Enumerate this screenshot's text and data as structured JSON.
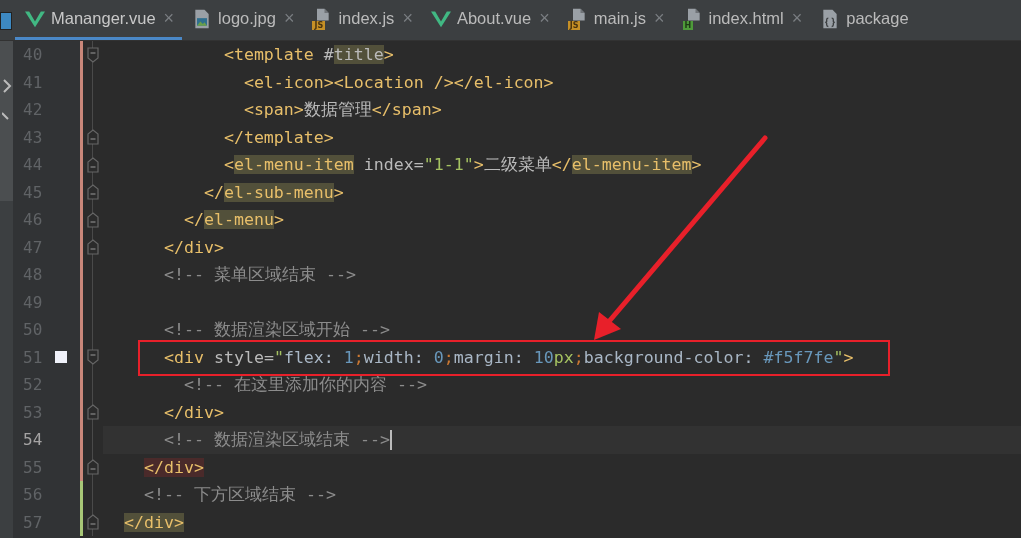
{
  "tabs": [
    {
      "label": "Mananger.vue",
      "kind": "vue",
      "selected": true,
      "close": "×"
    },
    {
      "label": "logo.jpg",
      "kind": "image",
      "selected": false,
      "close": "×"
    },
    {
      "label": "index.js",
      "kind": "js",
      "badge": "JS",
      "selected": false,
      "close": "×"
    },
    {
      "label": "About.vue",
      "kind": "vue",
      "selected": false,
      "close": "×"
    },
    {
      "label": "main.js",
      "kind": "js",
      "badge": "JS",
      "selected": false,
      "close": "×"
    },
    {
      "label": "index.html",
      "kind": "html",
      "badge": "H",
      "selected": false,
      "close": "×"
    },
    {
      "label": "package",
      "kind": "json",
      "selected": false
    }
  ],
  "lines": [
    {
      "number": "40",
      "fold_start": true,
      "fold_end": false,
      "added": false,
      "bookmark": false,
      "current": false,
      "tokens": [
        {
          "kind": "tag",
          "text": "          <template"
        },
        {
          "kind": "text",
          "text": " #"
        },
        {
          "kind": "text-hl",
          "text": "title"
        },
        {
          "kind": "tag",
          "text": ">"
        }
      ]
    },
    {
      "number": "41",
      "fold_start": false,
      "fold_end": false,
      "added": false,
      "bookmark": false,
      "current": false,
      "tokens": [
        {
          "kind": "tag",
          "text": "            <el-icon><Location /></el-icon>"
        }
      ]
    },
    {
      "number": "42",
      "fold_start": false,
      "fold_end": false,
      "added": false,
      "bookmark": false,
      "current": false,
      "tokens": [
        {
          "kind": "tag",
          "text": "            <span>"
        },
        {
          "kind": "text",
          "text": "数据管理"
        },
        {
          "kind": "tag",
          "text": "</span>"
        }
      ]
    },
    {
      "number": "43",
      "fold_start": false,
      "fold_end": true,
      "added": false,
      "bookmark": false,
      "current": false,
      "tokens": [
        {
          "kind": "tag",
          "text": "          </template>"
        }
      ]
    },
    {
      "number": "44",
      "fold_start": false,
      "fold_end": true,
      "added": false,
      "bookmark": false,
      "current": false,
      "tokens": [
        {
          "kind": "tag",
          "text": "          <"
        },
        {
          "kind": "tag-hl",
          "text": "el-menu-item"
        },
        {
          "kind": "attr",
          "text": " index="
        },
        {
          "kind": "str",
          "text": "\"1-1\""
        },
        {
          "kind": "tag",
          "text": ">"
        },
        {
          "kind": "text",
          "text": "二级菜单"
        },
        {
          "kind": "tag",
          "text": "</"
        },
        {
          "kind": "tag-hl",
          "text": "el-menu-item"
        },
        {
          "kind": "tag",
          "text": ">"
        }
      ]
    },
    {
      "number": "45",
      "fold_start": false,
      "fold_end": true,
      "added": false,
      "bookmark": false,
      "current": false,
      "tokens": [
        {
          "kind": "tag",
          "text": "        </"
        },
        {
          "kind": "tag-hl",
          "text": "el-sub-menu"
        },
        {
          "kind": "tag",
          "text": ">"
        }
      ]
    },
    {
      "number": "46",
      "fold_start": false,
      "fold_end": true,
      "added": false,
      "bookmark": false,
      "current": false,
      "tokens": [
        {
          "kind": "tag",
          "text": "      </"
        },
        {
          "kind": "tag-hl",
          "text": "el-menu"
        },
        {
          "kind": "tag",
          "text": ">"
        }
      ]
    },
    {
      "number": "47",
      "fold_start": false,
      "fold_end": true,
      "added": false,
      "bookmark": false,
      "current": false,
      "tokens": [
        {
          "kind": "tag",
          "text": "    </div>"
        }
      ]
    },
    {
      "number": "48",
      "fold_start": false,
      "fold_end": false,
      "added": false,
      "bookmark": false,
      "current": false,
      "tokens": [
        {
          "kind": "comment",
          "text": "    <!-- 菜单区域结束 -->"
        }
      ]
    },
    {
      "number": "49",
      "fold_start": false,
      "fold_end": false,
      "added": false,
      "bookmark": false,
      "current": false
    },
    {
      "number": "50",
      "fold_start": false,
      "fold_end": false,
      "added": false,
      "bookmark": false,
      "current": false,
      "tokens": [
        {
          "kind": "comment",
          "text": "    <!-- 数据渲染区域开始 -->"
        }
      ]
    },
    {
      "number": "51",
      "fold_start": true,
      "fold_end": false,
      "added": false,
      "bookmark": true,
      "current": false,
      "tokens": [
        {
          "kind": "tag",
          "text": "    <div"
        },
        {
          "kind": "attr",
          "text": " style="
        },
        {
          "kind": "str",
          "text": "\""
        },
        {
          "kind": "prop",
          "text": "flex: "
        },
        {
          "kind": "num",
          "text": "1"
        },
        {
          "kind": "semi",
          "text": ";"
        },
        {
          "kind": "prop",
          "text": "width: "
        },
        {
          "kind": "num",
          "text": "0"
        },
        {
          "kind": "semi",
          "text": ";"
        },
        {
          "kind": "prop",
          "text": "margin: "
        },
        {
          "kind": "num",
          "text": "10"
        },
        {
          "kind": "unit",
          "text": "px"
        },
        {
          "kind": "semi",
          "text": ";"
        },
        {
          "kind": "prop",
          "text": "background-color: "
        },
        {
          "kind": "num",
          "text": "#f5f7fe"
        },
        {
          "kind": "str",
          "text": "\""
        },
        {
          "kind": "tag",
          "text": ">"
        }
      ]
    },
    {
      "number": "52",
      "fold_start": false,
      "fold_end": false,
      "added": false,
      "bookmark": false,
      "current": false,
      "tokens": [
        {
          "kind": "comment",
          "text": "      <!-- 在这里添加你的内容 -->"
        }
      ]
    },
    {
      "number": "53",
      "fold_start": false,
      "fold_end": true,
      "added": false,
      "bookmark": false,
      "current": false,
      "tokens": [
        {
          "kind": "tag",
          "text": "    </div>"
        }
      ]
    },
    {
      "number": "54",
      "fold_start": false,
      "fold_end": false,
      "added": false,
      "bookmark": false,
      "current": true,
      "tokens": [
        {
          "kind": "comment",
          "text": "    <!-- 数据渲染区域结束 -->"
        }
      ]
    },
    {
      "number": "55",
      "fold_start": false,
      "fold_end": true,
      "added": false,
      "bookmark": false,
      "current": false,
      "tokens": [
        {
          "kind": "tag-err",
          "text": "  </div>"
        }
      ]
    },
    {
      "number": "56",
      "fold_start": false,
      "fold_end": false,
      "added": true,
      "bookmark": false,
      "current": false,
      "tokens": [
        {
          "kind": "comment",
          "text": "  <!-- 下方区域结束 -->"
        }
      ]
    },
    {
      "number": "57",
      "fold_start": false,
      "fold_end": true,
      "added": true,
      "bookmark": false,
      "current": false,
      "tokens": [
        {
          "kind": "tag-hl",
          "text": "</div>"
        }
      ]
    }
  ]
}
